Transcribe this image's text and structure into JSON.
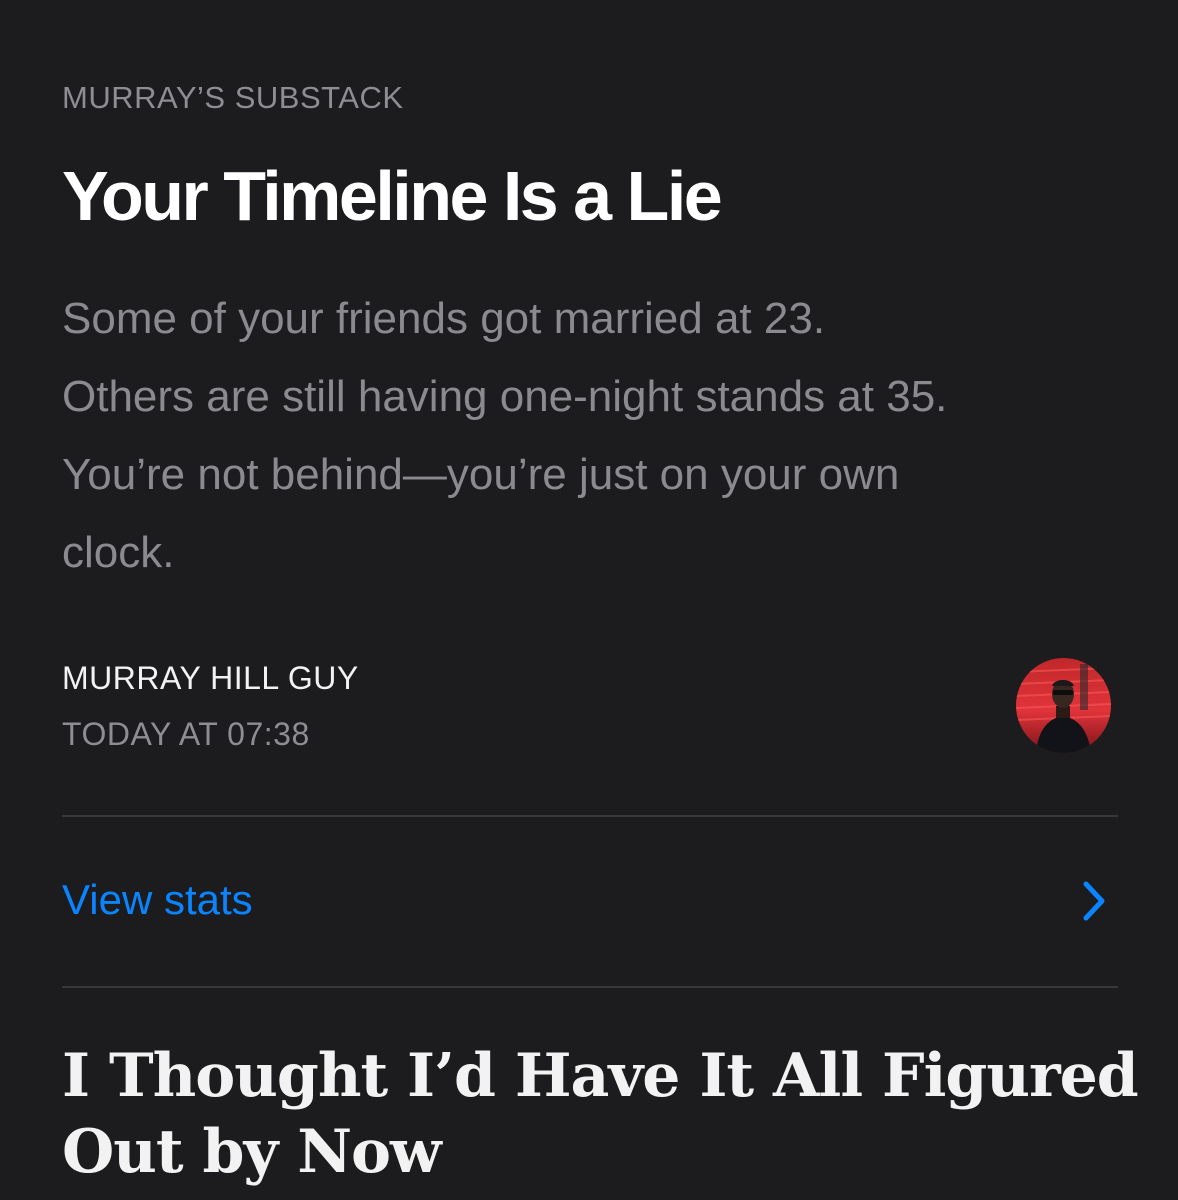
{
  "post": {
    "publication": "MURRAY’S SUBSTACK",
    "title": "Your Timeline Is a Lie",
    "subtitle_lines": [
      "Some of your friends got married at 23.",
      "Others are still having one-night stands at 35.",
      "You’re not behind—you’re just on your own",
      "clock."
    ],
    "author": "MURRAY HILL GUY",
    "date": "TODAY AT 07:38",
    "avatar_icon": "author-avatar"
  },
  "stats": {
    "label": "View stats",
    "icon": "chevron-right-icon"
  },
  "next_post": {
    "title_lines": [
      "I Thought I’d Have It All Figured",
      "Out by Now"
    ]
  },
  "colors": {
    "background": "#1c1c1e",
    "accent": "#0a84ff",
    "secondary_text": "#8d8d92",
    "primary_text": "#ffffff",
    "divider": "#38383a"
  }
}
